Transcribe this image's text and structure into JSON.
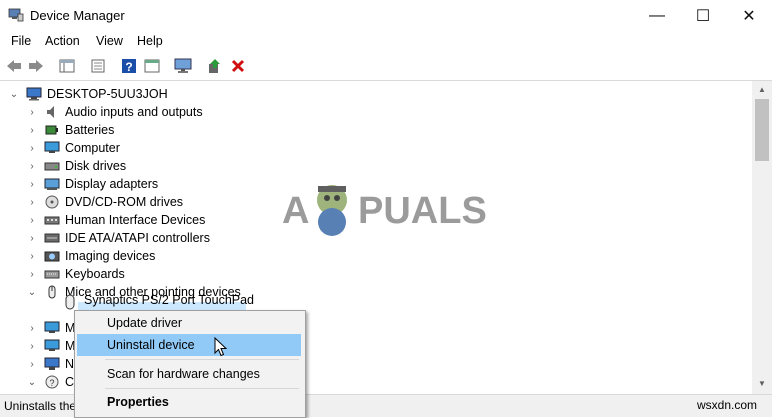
{
  "window": {
    "title": "Device Manager",
    "controls": {
      "minimize": "—",
      "maximize": "☐",
      "close": "✕"
    }
  },
  "menu": [
    "File",
    "Action",
    "View",
    "Help"
  ],
  "tree": {
    "root": "DESKTOP-5UU3JOH",
    "items": [
      {
        "label": "Audio inputs and outputs",
        "icon": "speaker-icon"
      },
      {
        "label": "Batteries",
        "icon": "battery-icon"
      },
      {
        "label": "Computer",
        "icon": "monitor-icon"
      },
      {
        "label": "Disk drives",
        "icon": "disk-icon"
      },
      {
        "label": "Display adapters",
        "icon": "display-adapter-icon"
      },
      {
        "label": "DVD/CD-ROM drives",
        "icon": "dvd-icon"
      },
      {
        "label": "Human Interface Devices",
        "icon": "hid-icon"
      },
      {
        "label": "IDE ATA/ATAPI controllers",
        "icon": "ide-icon"
      },
      {
        "label": "Imaging devices",
        "icon": "camera-icon"
      },
      {
        "label": "Keyboards",
        "icon": "keyboard-icon"
      },
      {
        "label": "Mice and other pointing devices",
        "icon": "mouse-icon"
      }
    ],
    "selected_child": "Synaptics PS/2 Port TouchPad",
    "partial_rows": [
      "M",
      "M",
      "N",
      "C"
    ]
  },
  "context_menu": {
    "items": [
      "Update driver",
      "Uninstall device",
      "Scan for hardware changes",
      "Properties"
    ],
    "highlighted": "Uninstall device"
  },
  "status": "Uninstalls the",
  "watermark": {
    "left": "A",
    "right": "PUALS"
  },
  "site": "wsxdn.com",
  "colors": {
    "highlight": "#91c9f7",
    "delete_red": "#d01010",
    "help_blue": "#1a4ea8"
  }
}
